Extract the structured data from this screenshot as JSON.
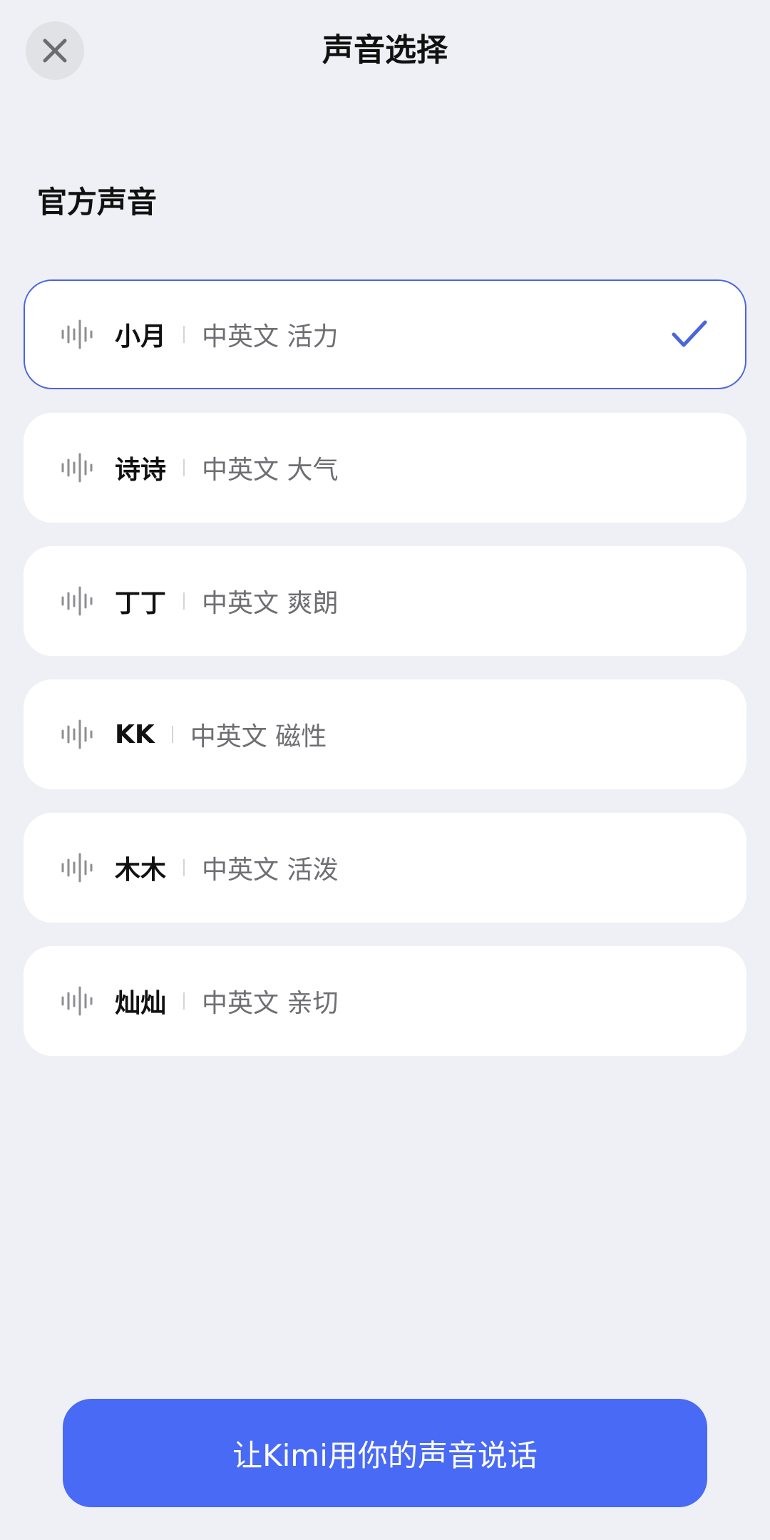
{
  "header": {
    "title": "声音选择",
    "close_icon": "close-icon"
  },
  "section": {
    "title": "官方声音"
  },
  "voices": [
    {
      "name": "小月",
      "desc": "中英文 活力",
      "selected": true
    },
    {
      "name": "诗诗",
      "desc": "中英文 大气",
      "selected": false
    },
    {
      "name": "丁丁",
      "desc": "中英文 爽朗",
      "selected": false
    },
    {
      "name": "KK",
      "desc": "中英文 磁性",
      "selected": false
    },
    {
      "name": "木木",
      "desc": "中英文 活泼",
      "selected": false
    },
    {
      "name": "灿灿",
      "desc": "中英文 亲切",
      "selected": false
    }
  ],
  "bottom_button": {
    "label": "让Kimi用你的声音说话"
  },
  "colors": {
    "accent": "#486AF5",
    "check": "#4B65DB",
    "background": "#EFF0F5"
  }
}
